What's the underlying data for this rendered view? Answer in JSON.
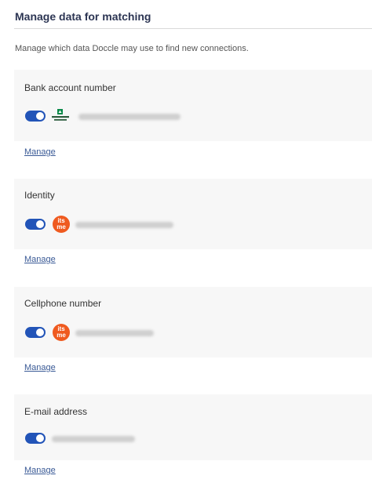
{
  "header": {
    "title": "Manage data for matching"
  },
  "description": "Manage which data Doccle may use to find new connections.",
  "cards": [
    {
      "label": "Bank account number",
      "toggle_on": true,
      "logo": "bnp-paribas-fortis-logo",
      "logo_text": "BNP PARIBAS FORTIS",
      "manage_label": "Manage"
    },
    {
      "label": "Identity",
      "toggle_on": true,
      "logo": "itsme-logo",
      "logo_text": "its me",
      "manage_label": "Manage"
    },
    {
      "label": "Cellphone number",
      "toggle_on": true,
      "logo": "itsme-logo",
      "logo_text": "its me",
      "manage_label": "Manage"
    },
    {
      "label": "E-mail address",
      "toggle_on": true,
      "logo": null,
      "manage_label": "Manage"
    }
  ],
  "colors": {
    "toggle_on": "#2254b8",
    "link": "#3a5a96",
    "itsme": "#ef5a1f",
    "card_bg": "#f7f7f7"
  }
}
